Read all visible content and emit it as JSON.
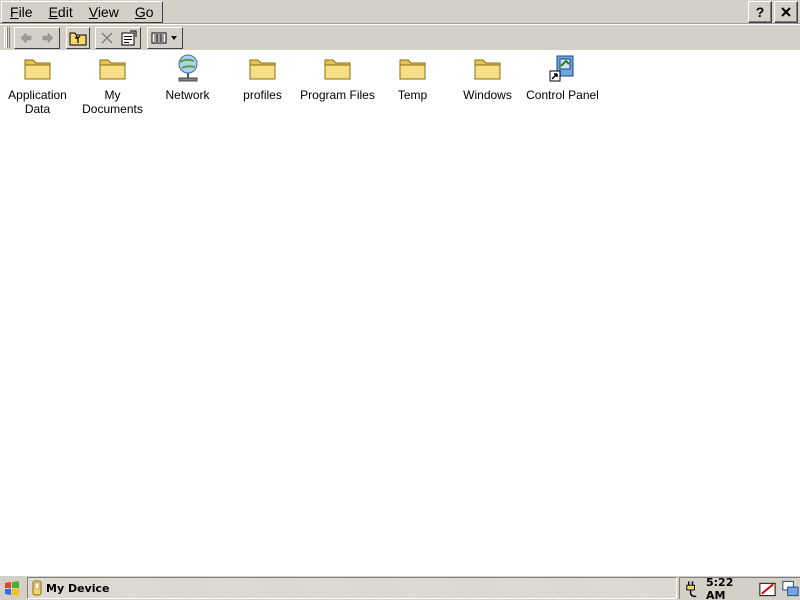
{
  "menubar": {
    "menus": [
      "File",
      "Edit",
      "View",
      "Go"
    ],
    "help_label": "?",
    "close_label": "X"
  },
  "toolbar": {
    "buttons": [
      "back-icon",
      "forward-icon",
      "up-folder-icon",
      "delete-icon",
      "properties-icon",
      "view-options-icon"
    ]
  },
  "items": [
    {
      "label": "Application Data",
      "icon": "folder-icon"
    },
    {
      "label": "My Documents",
      "icon": "folder-icon"
    },
    {
      "label": "Network",
      "icon": "network-icon"
    },
    {
      "label": "profiles",
      "icon": "folder-icon"
    },
    {
      "label": "Program Files",
      "icon": "folder-icon"
    },
    {
      "label": "Temp",
      "icon": "folder-icon"
    },
    {
      "label": "Windows",
      "icon": "folder-icon"
    },
    {
      "label": "Control Panel",
      "icon": "control-panel-shortcut-icon"
    }
  ],
  "taskbar": {
    "task_label": "My Device",
    "clock": "5:22 AM"
  },
  "colors": {
    "chrome": "#d4d0c8",
    "folder": "#f5d76e",
    "background": "#ffffff"
  }
}
